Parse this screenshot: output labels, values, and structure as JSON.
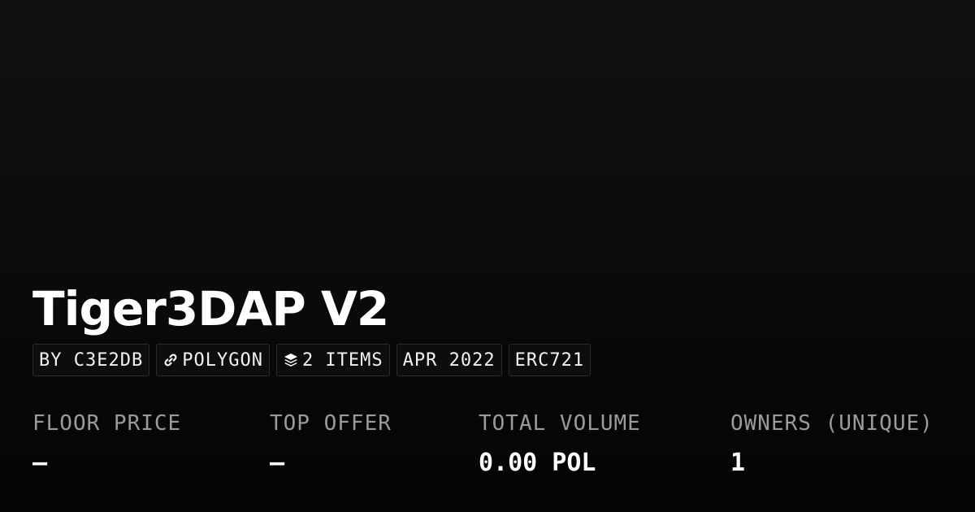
{
  "collection": {
    "title": "Tiger3DAP V2"
  },
  "tags": {
    "creator": "BY C3E2DB",
    "chain": "POLYGON",
    "chain_icon": "link-icon",
    "items": "2 ITEMS",
    "items_icon": "layers-icon",
    "date": "APR 2022",
    "standard": "ERC721"
  },
  "stats": {
    "floor_price": {
      "label": "FLOOR PRICE",
      "value": "–"
    },
    "top_offer": {
      "label": "TOP OFFER",
      "value": "–"
    },
    "total_volume": {
      "label": "TOTAL VOLUME",
      "value": "0.00 POL"
    },
    "owners": {
      "label": "OWNERS (UNIQUE)",
      "value": "1"
    }
  },
  "colors": {
    "background": "#0b0b0b",
    "text": "#ffffff",
    "muted": "#9b9b9b",
    "tag_border": "#2a2a2a"
  }
}
